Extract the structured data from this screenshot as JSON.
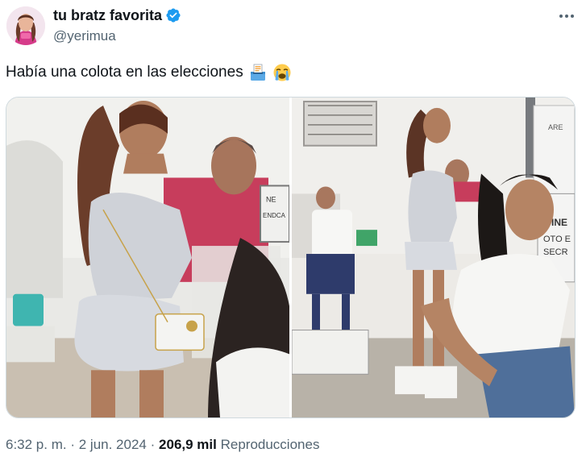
{
  "author": {
    "display_name": "tu bratz favorita",
    "handle": "@yerimua",
    "verified_icon": "verified-badge-icon",
    "verified_color": "#1d9bf0"
  },
  "tweet": {
    "text": "Había una colota en las elecciones",
    "emojis": [
      "ballot-box-icon",
      "loudly-crying-face-icon"
    ]
  },
  "media": {
    "photos": [
      {
        "name": "photo-left",
        "sign_texts": [
          "NE",
          "ENDCA"
        ]
      },
      {
        "name": "photo-right",
        "sign_texts": [
          "INE",
          "OTO E",
          "SECR",
          "ARE"
        ]
      }
    ]
  },
  "meta": {
    "time": "6:32 p. m.",
    "separator": "·",
    "date": "2 jun. 2024",
    "views_count": "206,9 mil",
    "views_label": "Reproducciones"
  },
  "more_icon": "more-dots-icon"
}
